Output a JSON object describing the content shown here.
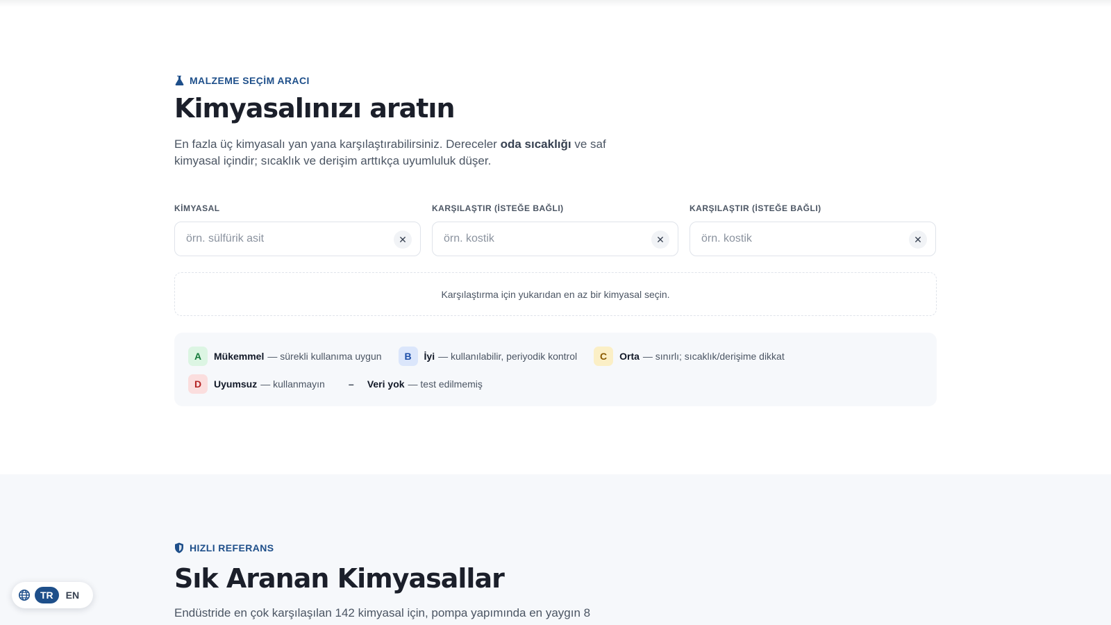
{
  "tool": {
    "eyebrow": "MALZEME SEÇİM ARACI",
    "title": "Kimyasalınızı aratın",
    "intro_before": "En fazla üç kimyasalı yan yana karşılaştırabilirsiniz. Dereceler ",
    "intro_bold": "oda sıcaklığı",
    "intro_after": " ve saf kimyasal içindir; sıcaklık ve derişim arttıkça uyumluluk düşer.",
    "fields": [
      {
        "label": "KİMYASAL",
        "placeholder": "örn. sülfürik asit",
        "value": "",
        "clear": "✕"
      },
      {
        "label": "KARŞILAŞTIR (İSTEĞE BAĞLI)",
        "placeholder": "örn. kostik",
        "value": "",
        "clear": "✕"
      },
      {
        "label": "KARŞILAŞTIR (İSTEĞE BAĞLI)",
        "placeholder": "örn. kostik",
        "value": "",
        "clear": "✕"
      }
    ],
    "empty_message": "Karşılaştırma için yukarıdan en az bir kimyasal seçin.",
    "legend": [
      {
        "grade": "A",
        "name": "Mükemmel",
        "desc": "— sürekli kullanıma uygun",
        "color": "#157a3b"
      },
      {
        "grade": "B",
        "name": "İyi",
        "desc": "— kullanılabilir, periyodik kontrol",
        "color": "#1d4ea8"
      },
      {
        "grade": "C",
        "name": "Orta",
        "desc": "— sınırlı; sıcaklık/derişime dikkat",
        "color": "#8a5a00"
      },
      {
        "grade": "D",
        "name": "Uyumsuz",
        "desc": "— kullanmayın",
        "color": "#b42323"
      },
      {
        "grade": "–",
        "name": "Veri yok",
        "desc": "— test edilmemiş",
        "color": "#374151"
      }
    ]
  },
  "reference": {
    "eyebrow": "HIZLI REFERANS",
    "title": "Sık Aranan Kimyasallar",
    "intro": "Endüstride en çok karşılaşılan 142 kimyasal için, pompa yapımında en yaygın 8"
  },
  "language": {
    "icon": "globe-icon",
    "options": [
      "TR",
      "EN"
    ],
    "selected": "TR"
  },
  "colors": {
    "accent": "#1e4f8a",
    "text_dark": "#1b1f2a",
    "section_bg": "#f6f8fb"
  }
}
